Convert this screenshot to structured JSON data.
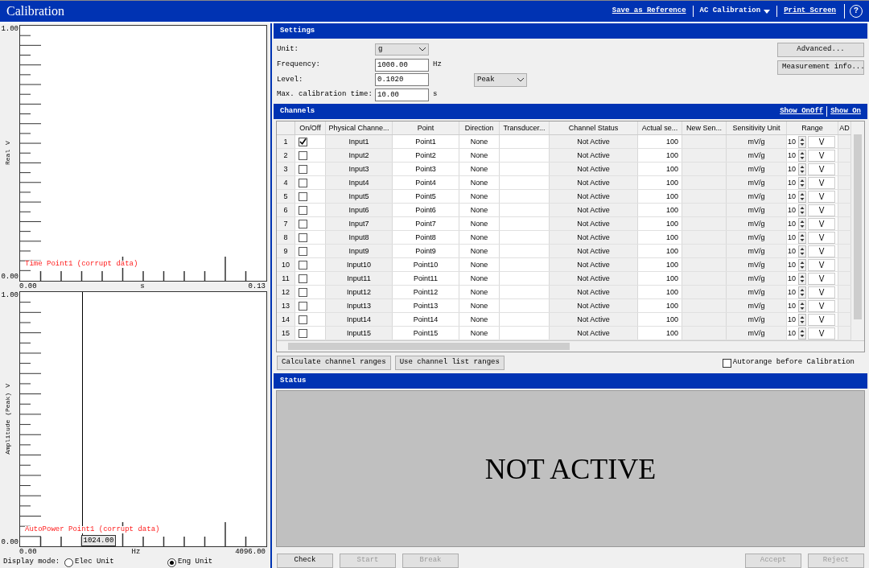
{
  "window": {
    "title": "Calibration",
    "links": [
      {
        "label": "Save as Reference",
        "kind": "link"
      },
      {
        "label": "AC Calibration",
        "kind": "dropdown"
      },
      {
        "label": "Print Screen",
        "kind": "link"
      }
    ],
    "help": "?"
  },
  "plots": [
    {
      "y_max": "1.00",
      "y_min": "0.00",
      "y_unit": "V",
      "y_title": "Real",
      "trace_label": "Time Point1 (corrupt data)",
      "x_min": "0.00",
      "x_unit": "s",
      "x_max": "0.13"
    },
    {
      "y_max": "1.00",
      "y_min": "0.00",
      "y_unit": "V",
      "y_title": "Amplitude (Peak)",
      "trace_label": "AutoPower Point1 (corrupt data)",
      "x_min": "0.00",
      "x_unit": "Hz",
      "x_max": "4096.00",
      "cursor": "1024.00"
    }
  ],
  "display_mode": {
    "label": "Display mode:",
    "options": [
      {
        "label": "Elec Unit",
        "selected": false
      },
      {
        "label": "Eng Unit",
        "selected": true
      }
    ]
  },
  "settings": {
    "title": "Settings",
    "fields": [
      {
        "label": "Unit:",
        "value": "g",
        "kind": "select"
      },
      {
        "label": "Frequency:",
        "value": "1000.00",
        "unit": "Hz",
        "kind": "input"
      },
      {
        "label": "Level:",
        "value": "0.1020",
        "kind": "input",
        "mode": "Peak"
      },
      {
        "label": "Max. calibration time:",
        "value": "10.00",
        "unit": "s",
        "kind": "input"
      }
    ],
    "buttons": [
      "Advanced...",
      "Measurement info..."
    ]
  },
  "channels": {
    "title": "Channels",
    "links": [
      "Show OnOff",
      "Show On"
    ],
    "columns": [
      "On/Off",
      "Physical Channe...",
      "Point",
      "Direction",
      "Transducer...",
      "Channel Status",
      "Actual se...",
      "New Sen...",
      "Sensitivity Unit",
      "Range",
      "AD"
    ],
    "rows": [
      {
        "index": "1",
        "on": true,
        "physical": "Input1",
        "point": "Point1",
        "direction": "None",
        "status": "Not Active",
        "actual": "100",
        "unit": "mV/g",
        "range": "10",
        "range_unit": "V"
      },
      {
        "index": "2",
        "on": false,
        "physical": "Input2",
        "point": "Point2",
        "direction": "None",
        "status": "Not Active",
        "actual": "100",
        "unit": "mV/g",
        "range": "10",
        "range_unit": "V"
      },
      {
        "index": "3",
        "on": false,
        "physical": "Input3",
        "point": "Point3",
        "direction": "None",
        "status": "Not Active",
        "actual": "100",
        "unit": "mV/g",
        "range": "10",
        "range_unit": "V"
      },
      {
        "index": "4",
        "on": false,
        "physical": "Input4",
        "point": "Point4",
        "direction": "None",
        "status": "Not Active",
        "actual": "100",
        "unit": "mV/g",
        "range": "10",
        "range_unit": "V"
      },
      {
        "index": "5",
        "on": false,
        "physical": "Input5",
        "point": "Point5",
        "direction": "None",
        "status": "Not Active",
        "actual": "100",
        "unit": "mV/g",
        "range": "10",
        "range_unit": "V"
      },
      {
        "index": "6",
        "on": false,
        "physical": "Input6",
        "point": "Point6",
        "direction": "None",
        "status": "Not Active",
        "actual": "100",
        "unit": "mV/g",
        "range": "10",
        "range_unit": "V"
      },
      {
        "index": "7",
        "on": false,
        "physical": "Input7",
        "point": "Point7",
        "direction": "None",
        "status": "Not Active",
        "actual": "100",
        "unit": "mV/g",
        "range": "10",
        "range_unit": "V"
      },
      {
        "index": "8",
        "on": false,
        "physical": "Input8",
        "point": "Point8",
        "direction": "None",
        "status": "Not Active",
        "actual": "100",
        "unit": "mV/g",
        "range": "10",
        "range_unit": "V"
      },
      {
        "index": "9",
        "on": false,
        "physical": "Input9",
        "point": "Point9",
        "direction": "None",
        "status": "Not Active",
        "actual": "100",
        "unit": "mV/g",
        "range": "10",
        "range_unit": "V"
      },
      {
        "index": "10",
        "on": false,
        "physical": "Input10",
        "point": "Point10",
        "direction": "None",
        "status": "Not Active",
        "actual": "100",
        "unit": "mV/g",
        "range": "10",
        "range_unit": "V"
      },
      {
        "index": "11",
        "on": false,
        "physical": "Input11",
        "point": "Point11",
        "direction": "None",
        "status": "Not Active",
        "actual": "100",
        "unit": "mV/g",
        "range": "10",
        "range_unit": "V"
      },
      {
        "index": "12",
        "on": false,
        "physical": "Input12",
        "point": "Point12",
        "direction": "None",
        "status": "Not Active",
        "actual": "100",
        "unit": "mV/g",
        "range": "10",
        "range_unit": "V"
      },
      {
        "index": "13",
        "on": false,
        "physical": "Input13",
        "point": "Point13",
        "direction": "None",
        "status": "Not Active",
        "actual": "100",
        "unit": "mV/g",
        "range": "10",
        "range_unit": "V"
      },
      {
        "index": "14",
        "on": false,
        "physical": "Input14",
        "point": "Point14",
        "direction": "None",
        "status": "Not Active",
        "actual": "100",
        "unit": "mV/g",
        "range": "10",
        "range_unit": "V"
      },
      {
        "index": "15",
        "on": false,
        "physical": "Input15",
        "point": "Point15",
        "direction": "None",
        "status": "Not Active",
        "actual": "100",
        "unit": "mV/g",
        "range": "10",
        "range_unit": "V"
      }
    ],
    "buttons": [
      "Calculate channel ranges",
      "Use channel list ranges"
    ],
    "autorange": {
      "label": "Autorange before Calibration",
      "checked": false
    }
  },
  "status": {
    "title": "Status",
    "message": "NOT ACTIVE"
  },
  "footer_buttons": [
    {
      "label": "Check",
      "disabled": false
    },
    {
      "label": "Start",
      "disabled": true
    },
    {
      "label": "Break",
      "disabled": true
    },
    {
      "label": "Accept",
      "disabled": true
    },
    {
      "label": "Reject",
      "disabled": true
    }
  ]
}
